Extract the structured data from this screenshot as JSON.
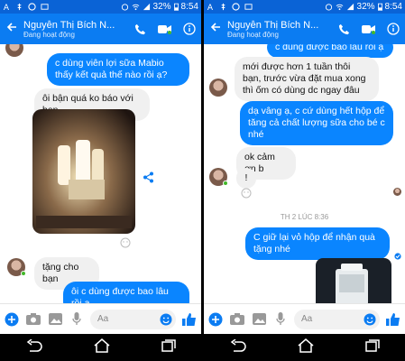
{
  "colors": {
    "status_bar": "#0a63d6",
    "app_bar": "#0b7cf2",
    "outgoing_bubble": "#0a85ff",
    "incoming_bubble": "#f0f0f0",
    "online": "#42b72a"
  },
  "left": {
    "status": {
      "battery": "32%",
      "time": "8:54"
    },
    "header": {
      "name": "Nguyễn Thị Bích N...",
      "status": "Đang hoạt động"
    },
    "messages": [
      {
        "from": "me",
        "text": "c dùng viên lợi sữa Mabio thấy kết quả thế nào rồi ạ?"
      },
      {
        "from": "them",
        "text": "ôi bận quá ko báo với bạn"
      },
      {
        "from": "them",
        "text": "tặng cho bạn"
      },
      {
        "from": "me",
        "text": "ôi c dùng được bao lâu rồi ạ"
      }
    ],
    "composer": {
      "placeholder": "Aa"
    }
  },
  "right": {
    "status": {
      "battery": "32%",
      "time": "8:54"
    },
    "header": {
      "name": "Nguyễn Thị Bích N...",
      "status": "Đang hoạt động"
    },
    "messages": [
      {
        "from": "me",
        "text": "c dùng được bao lâu rồi ạ"
      },
      {
        "from": "them",
        "text": "mới được hơn 1 tuần thôi bạn, trước vừa đặt mua xong thì ốm có dùng dc ngay đâu"
      },
      {
        "from": "me",
        "text": "dạ vâng ạ, c cứ dùng hết hộp để tăng cả chất lượng sữa cho bé c nhé"
      },
      {
        "from": "them",
        "text": "ok cảm ơn b"
      },
      {
        "from": "them",
        "text": "!"
      },
      {
        "from": "me",
        "text": "C giữ lại vỏ hộp để nhận quà tặng nhé"
      }
    ],
    "timestamp": "TH 2 LÚC 8:36",
    "composer": {
      "placeholder": "Aa"
    }
  },
  "icons": [
    "back-arrow-icon",
    "phone-icon",
    "video-icon",
    "info-icon",
    "plus-icon",
    "camera-icon",
    "gallery-icon",
    "mic-icon",
    "emoji-icon",
    "like-icon",
    "share-icon",
    "nav-back-icon",
    "nav-home-icon",
    "nav-recents-icon"
  ]
}
